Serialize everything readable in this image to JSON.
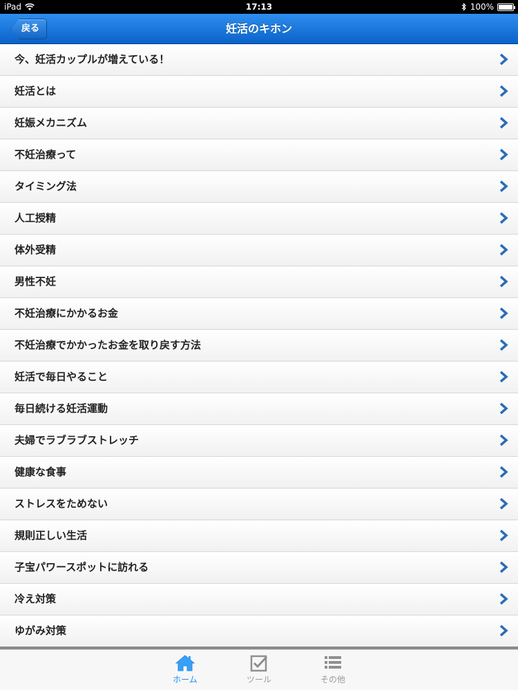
{
  "status_bar": {
    "device": "iPad",
    "time": "17:13",
    "battery": "100%",
    "battery_level": 1.0
  },
  "nav": {
    "back_label": "戻る",
    "title": "妊活のキホン"
  },
  "list": {
    "items": [
      {
        "label": "今、妊活カップルが増えている！"
      },
      {
        "label": "妊活とは"
      },
      {
        "label": "妊娠メカニズム"
      },
      {
        "label": "不妊治療って"
      },
      {
        "label": "タイミング法"
      },
      {
        "label": "人工授精"
      },
      {
        "label": "体外受精"
      },
      {
        "label": "男性不妊"
      },
      {
        "label": "不妊治療にかかるお金"
      },
      {
        "label": "不妊治療でかかったお金を取り戻す方法"
      },
      {
        "label": "妊活で毎日やること"
      },
      {
        "label": "毎日続ける妊活運動"
      },
      {
        "label": "夫婦でラブラブストレッチ"
      },
      {
        "label": "健康な食事"
      },
      {
        "label": "ストレスをためない"
      },
      {
        "label": "規則正しい生活"
      },
      {
        "label": "子宝パワースポットに訪れる"
      },
      {
        "label": "冷え対策"
      },
      {
        "label": "ゆがみ対策"
      }
    ],
    "chevron_icon": "chevron-right-icon",
    "chevron_color": "#2a6db8"
  },
  "tab_bar": {
    "tabs": [
      {
        "label": "ホーム",
        "icon": "home-icon",
        "selected": true
      },
      {
        "label": "ツール",
        "icon": "checkbox-icon",
        "selected": false
      },
      {
        "label": "その他",
        "icon": "list-icon",
        "selected": false
      }
    ],
    "active_color": "#1f8df0",
    "inactive_color": "#9a9a9a"
  }
}
